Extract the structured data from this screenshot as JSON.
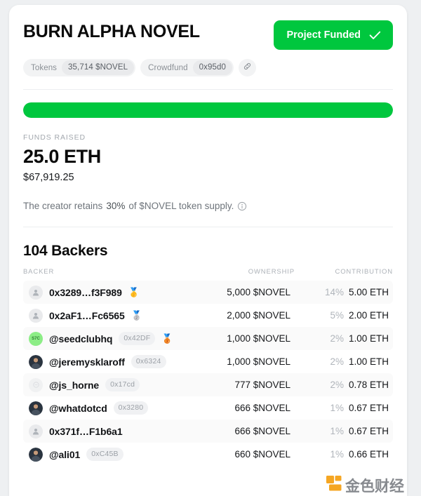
{
  "header": {
    "title": "BURN ALPHA NOVEL",
    "status_button": {
      "label": "Project Funded",
      "icon": "check-icon",
      "color": "#00c73e"
    },
    "pills": [
      {
        "key": "Tokens",
        "value": "35,714 $NOVEL"
      },
      {
        "key": "Crowdfund",
        "value": "0x95d0"
      }
    ],
    "link_icon": "link-icon"
  },
  "progress": {
    "percent": 100,
    "fill_color": "#00c73e",
    "track_color": "#edeef0"
  },
  "funds": {
    "label": "FUNDS RAISED",
    "eth": "25.0 ETH",
    "usd": "$67,919.25"
  },
  "creator_note": {
    "prefix": "The creator retains ",
    "percent": "30%",
    "suffix": " of $NOVEL token supply.",
    "info_icon": "info-icon"
  },
  "backers": {
    "heading": "104 Backers",
    "columns": {
      "backer": "BACKER",
      "ownership": "OWNERSHIP",
      "contribution": "CONTRIBUTION"
    },
    "rows": [
      {
        "name": "0x3289…f3F989",
        "suffix": "",
        "medal": "🥇",
        "avatar": "generic-person-icon",
        "avatar_label": "",
        "ownership": "5,000 $NOVEL",
        "percent": "14%",
        "contribution": "5.00 ETH"
      },
      {
        "name": "0x2aF1…Fc6565",
        "suffix": "",
        "medal": "🥈",
        "avatar": "generic-person-icon",
        "avatar_label": "",
        "ownership": "2,000 $NOVEL",
        "percent": "5%",
        "contribution": "2.00 ETH"
      },
      {
        "name": "@seedclubhq",
        "suffix": "0x42DF",
        "medal": "🥉",
        "avatar": "seedclub-avatar",
        "avatar_label": "S7C",
        "ownership": "1,000 $NOVEL",
        "percent": "2%",
        "contribution": "1.00 ETH"
      },
      {
        "name": "@jeremysklaroff",
        "suffix": "0x6324",
        "medal": "",
        "avatar": "photo-avatar",
        "avatar_label": "",
        "ownership": "1,000 $NOVEL",
        "percent": "2%",
        "contribution": "1.00 ETH"
      },
      {
        "name": "@js_horne",
        "suffix": "0x17cd",
        "medal": "",
        "avatar": "faint-avatar",
        "avatar_label": "",
        "ownership": "777 $NOVEL",
        "percent": "2%",
        "contribution": "0.78 ETH"
      },
      {
        "name": "@whatdotcd",
        "suffix": "0x3280",
        "medal": "",
        "avatar": "photo-avatar",
        "avatar_label": "",
        "ownership": "666 $NOVEL",
        "percent": "1%",
        "contribution": "0.67 ETH"
      },
      {
        "name": "0x371f…F1b6a1",
        "suffix": "",
        "medal": "",
        "avatar": "generic-person-icon",
        "avatar_label": "",
        "ownership": "666 $NOVEL",
        "percent": "1%",
        "contribution": "0.67 ETH"
      },
      {
        "name": "@ali01",
        "suffix": "0xC45B",
        "medal": "",
        "avatar": "photo-avatar",
        "avatar_label": "",
        "ownership": "660 $NOVEL",
        "percent": "1%",
        "contribution": "0.66 ETH"
      }
    ]
  },
  "watermark": {
    "text": "金色财经",
    "logo_color": "#f5a623"
  }
}
